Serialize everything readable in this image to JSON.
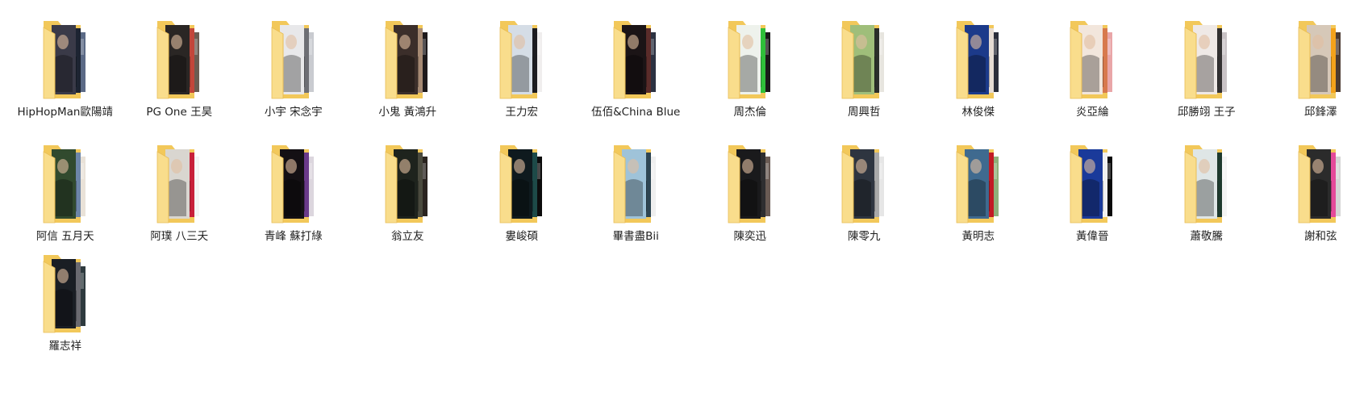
{
  "folders": [
    {
      "name": "HipHopMan歐陽靖",
      "photos": [
        "#3a3a48",
        "#1d2432",
        "#5b6a86"
      ]
    },
    {
      "name": "PG One 王昊",
      "photos": [
        "#2a2624",
        "#c2463a",
        "#6b5d52"
      ]
    },
    {
      "name": "小宇 宋念宇",
      "photos": [
        "#e8e8ea",
        "#6d6e74",
        "#c9cbd0"
      ]
    },
    {
      "name": "小鬼 黃鴻升",
      "photos": [
        "#3b2e2a",
        "#a68a74",
        "#1e1a1c"
      ]
    },
    {
      "name": "王力宏",
      "photos": [
        "#d5dde6",
        "#1c1c20",
        "#f0eeee"
      ]
    },
    {
      "name": "伍佰&China Blue",
      "photos": [
        "#1b1416",
        "#5a2c2a",
        "#2c3242"
      ]
    },
    {
      "name": "周杰倫",
      "photos": [
        "#eef2ec",
        "#2fbf3a",
        "#1a1a1a"
      ]
    },
    {
      "name": "周興哲",
      "photos": [
        "#9fbe7a",
        "#2a2d2a",
        "#e7e5df"
      ]
    },
    {
      "name": "林俊傑",
      "photos": [
        "#1c3a8a",
        "#e6dcd3",
        "#2b2e3a"
      ]
    },
    {
      "name": "炎亞綸",
      "photos": [
        "#f2e6dc",
        "#d7794d",
        "#e9a6a8"
      ]
    },
    {
      "name": "邱勝翊 王子",
      "photos": [
        "#efe9e6",
        "#333131",
        "#c9c3c6"
      ]
    },
    {
      "name": "邱鋒澤",
      "photos": [
        "#d6c8b8",
        "#f3a21b",
        "#4b3b32"
      ]
    },
    {
      "name": "阿信 五月天",
      "photos": [
        "#314a2e",
        "#6d86a8",
        "#e9e2d8"
      ]
    },
    {
      "name": "阿璞 八三夭",
      "photos": [
        "#d9d6d0",
        "#c8203a",
        "#f4f4f4"
      ]
    },
    {
      "name": "青峰 蘇打綠",
      "photos": [
        "#141014",
        "#6a3a8a",
        "#dcd6de"
      ]
    },
    {
      "name": "翁立友",
      "photos": [
        "#1e231d",
        "#4a4a3e",
        "#2a2420"
      ]
    },
    {
      "name": "婁峻碩",
      "photos": [
        "#0f1a1e",
        "#1d4a48",
        "#0c0c0c"
      ]
    },
    {
      "name": "畢書盡Bii",
      "photos": [
        "#9fc3d9",
        "#2e4552",
        "#efefef"
      ]
    },
    {
      "name": "陳奕迅",
      "photos": [
        "#1a1a1c",
        "#2e2e30",
        "#6a5b54"
      ]
    },
    {
      "name": "陳零九",
      "photos": [
        "#2e3540",
        "#a9a9a9",
        "#e6e6e6"
      ]
    },
    {
      "name": "黃明志",
      "photos": [
        "#3f6a8f",
        "#c21a24",
        "#8fb07a"
      ]
    },
    {
      "name": "黃偉晉",
      "photos": [
        "#1a3a9a",
        "#f1f1f1",
        "#0a0a0a"
      ]
    },
    {
      "name": "蕭敬騰",
      "photos": [
        "#dfe6e6",
        "#1e3a2e",
        "#f4f4f4"
      ]
    },
    {
      "name": "謝和弦",
      "photos": [
        "#2b2b2b",
        "#e54a9a",
        "#d5d5d5"
      ]
    },
    {
      "name": "羅志祥",
      "photos": [
        "#1a1e24",
        "#6a6a70",
        "#2e3a3e"
      ]
    }
  ],
  "colors": {
    "folder_back": "#f2c85a",
    "folder_front": "#f9dd8c",
    "folder_front_edge": "#e9bd55",
    "label_text": "#1f1f1f"
  }
}
